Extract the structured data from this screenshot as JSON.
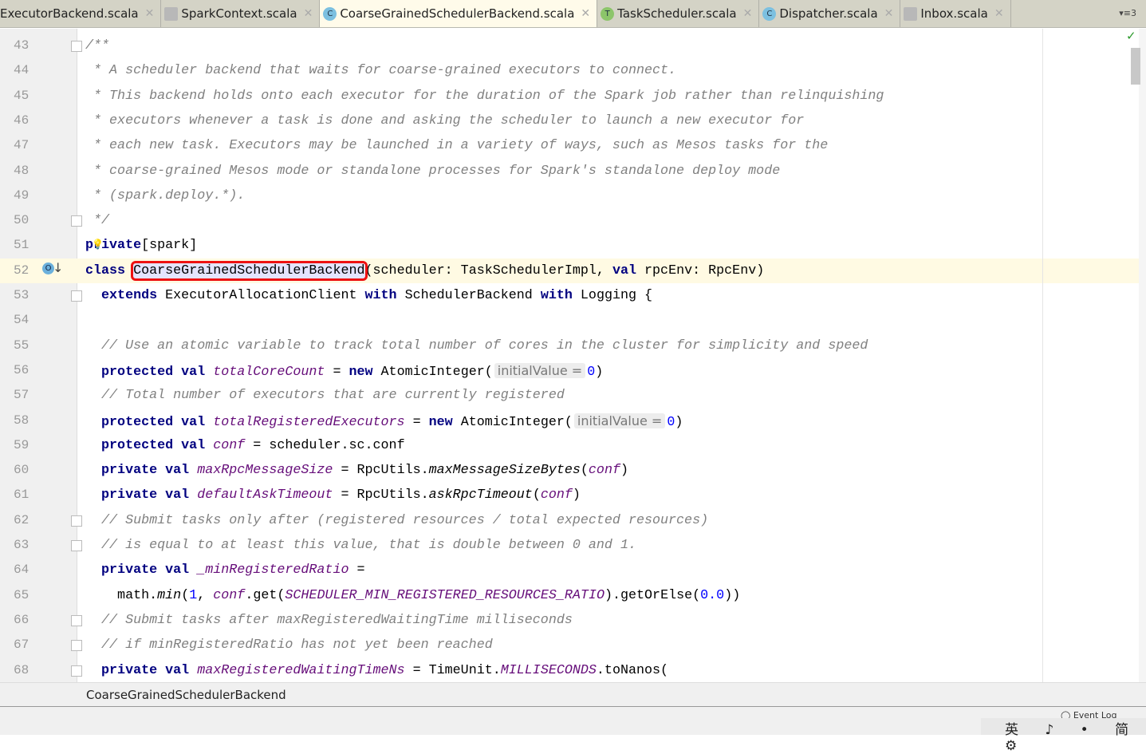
{
  "tabs": [
    {
      "label": "ExecutorBackend.scala",
      "icon": "scala-object-icon",
      "active": false
    },
    {
      "label": "SparkContext.scala",
      "icon": "scala-file-icon",
      "active": false
    },
    {
      "label": "CoarseGrainedSchedulerBackend.scala",
      "icon": "scala-class-icon",
      "active": true
    },
    {
      "label": "TaskScheduler.scala",
      "icon": "scala-trait-icon",
      "active": false
    },
    {
      "label": "Dispatcher.scala",
      "icon": "scala-class-icon",
      "active": false
    },
    {
      "label": "Inbox.scala",
      "icon": "scala-file-icon",
      "active": false
    }
  ],
  "tabs_more": "▾≡3",
  "colors": {
    "keyword": "#000080",
    "comment": "#808080",
    "field": "#660e7a",
    "number": "#0000ff",
    "highlight_box": "#ee1111",
    "current_line": "#fffae3"
  },
  "current_line": 52,
  "lines": [
    {
      "n": "43",
      "fold": true,
      "t": [
        [
          "cm",
          "/**"
        ]
      ]
    },
    {
      "n": "44",
      "t": [
        [
          "cm",
          " * A scheduler backend that waits for coarse-grained executors to connect."
        ]
      ]
    },
    {
      "n": "45",
      "t": [
        [
          "cm",
          " * This backend holds onto each executor for the duration of the Spark job rather than relinquishing"
        ]
      ]
    },
    {
      "n": "46",
      "t": [
        [
          "cm",
          " * executors whenever a task is done and asking the scheduler to launch a new executor for"
        ]
      ]
    },
    {
      "n": "47",
      "t": [
        [
          "cm",
          " * each new task. Executors may be launched in a variety of ways, such as Mesos tasks for the"
        ]
      ]
    },
    {
      "n": "48",
      "t": [
        [
          "cm",
          " * coarse-grained Mesos mode or standalone processes for Spark's standalone deploy mode"
        ]
      ]
    },
    {
      "n": "49",
      "t": [
        [
          "cm",
          " * (spark.deploy.*)."
        ]
      ]
    },
    {
      "n": "50",
      "fold": true,
      "t": [
        [
          "cm",
          " */"
        ]
      ]
    },
    {
      "n": "51",
      "t": [
        [
          "kw",
          "private"
        ],
        [
          "",
          "[spark]"
        ]
      ]
    },
    {
      "n": "52",
      "t": [
        [
          "kw",
          "class "
        ],
        [
          "hl",
          "CoarseGrainedSchedulerBackend"
        ],
        [
          "",
          "(scheduler: TaskSchedulerImpl, "
        ],
        [
          "kw",
          "val "
        ],
        [
          "",
          "rpcEnv: RpcEnv)"
        ]
      ]
    },
    {
      "n": "53",
      "fold": true,
      "t": [
        [
          "",
          "  "
        ],
        [
          "kw",
          "extends "
        ],
        [
          "",
          "ExecutorAllocationClient "
        ],
        [
          "kw",
          "with "
        ],
        [
          "",
          "SchedulerBackend "
        ],
        [
          "kw",
          "with "
        ],
        [
          "",
          "Logging {"
        ]
      ]
    },
    {
      "n": "54",
      "t": []
    },
    {
      "n": "55",
      "t": [
        [
          "cm",
          "  // Use an atomic variable to track total number of cores in the cluster for simplicity and speed"
        ]
      ]
    },
    {
      "n": "56",
      "t": [
        [
          "kw",
          "  protected val "
        ],
        [
          "fld",
          "totalCoreCount"
        ],
        [
          "",
          " = "
        ],
        [
          "kw",
          "new "
        ],
        [
          "",
          "AtomicInteger("
        ],
        [
          "hint",
          "initialValue ="
        ],
        [
          "num",
          "0"
        ],
        [
          "",
          ")"
        ]
      ]
    },
    {
      "n": "57",
      "t": [
        [
          "cm",
          "  // Total number of executors that are currently registered"
        ]
      ]
    },
    {
      "n": "58",
      "t": [
        [
          "kw",
          "  protected val "
        ],
        [
          "fld",
          "totalRegisteredExecutors"
        ],
        [
          "",
          " = "
        ],
        [
          "kw",
          "new "
        ],
        [
          "",
          "AtomicInteger("
        ],
        [
          "hint",
          "initialValue ="
        ],
        [
          "num",
          "0"
        ],
        [
          "",
          ")"
        ]
      ]
    },
    {
      "n": "59",
      "t": [
        [
          "kw",
          "  protected val "
        ],
        [
          "fld",
          "conf"
        ],
        [
          "",
          " = scheduler.sc.conf"
        ]
      ]
    },
    {
      "n": "60",
      "t": [
        [
          "kw",
          "  private val "
        ],
        [
          "fld",
          "maxRpcMessageSize"
        ],
        [
          "",
          " = RpcUtils."
        ],
        [
          "it",
          "maxMessageSizeBytes"
        ],
        [
          "",
          "("
        ],
        [
          "fld",
          "conf"
        ],
        [
          "",
          ")"
        ]
      ]
    },
    {
      "n": "61",
      "t": [
        [
          "kw",
          "  private val "
        ],
        [
          "fld",
          "defaultAskTimeout"
        ],
        [
          "",
          " = RpcUtils."
        ],
        [
          "it",
          "askRpcTimeout"
        ],
        [
          "",
          "("
        ],
        [
          "fld",
          "conf"
        ],
        [
          "",
          ")"
        ]
      ]
    },
    {
      "n": "62",
      "fold": true,
      "t": [
        [
          "cm",
          "  // Submit tasks only after (registered resources / total expected resources)"
        ]
      ]
    },
    {
      "n": "63",
      "fold": true,
      "t": [
        [
          "cm",
          "  // is equal to at least this value, that is double between 0 and 1."
        ]
      ]
    },
    {
      "n": "64",
      "t": [
        [
          "kw",
          "  private val "
        ],
        [
          "fld",
          "_minRegisteredRatio"
        ],
        [
          "",
          " ="
        ]
      ]
    },
    {
      "n": "65",
      "t": [
        [
          "",
          "    math."
        ],
        [
          "it",
          "min"
        ],
        [
          "",
          "("
        ],
        [
          "num",
          "1"
        ],
        [
          "",
          ", "
        ],
        [
          "fld",
          "conf"
        ],
        [
          "",
          ".get("
        ],
        [
          "fld",
          "SCHEDULER_MIN_REGISTERED_RESOURCES_RATIO"
        ],
        [
          "",
          ").getOrElse("
        ],
        [
          "num",
          "0.0"
        ],
        [
          "",
          "))"
        ]
      ]
    },
    {
      "n": "66",
      "fold": true,
      "t": [
        [
          "cm",
          "  // Submit tasks after maxRegisteredWaitingTime milliseconds"
        ]
      ]
    },
    {
      "n": "67",
      "fold": true,
      "t": [
        [
          "cm",
          "  // if minRegisteredRatio has not yet been reached"
        ]
      ]
    },
    {
      "n": "68",
      "fold": true,
      "t": [
        [
          "kw",
          "  private val "
        ],
        [
          "fld",
          "maxRegisteredWaitingTimeNs"
        ],
        [
          "",
          " = TimeUnit."
        ],
        [
          "fld",
          "MILLISECONDS"
        ],
        [
          "",
          ".toNanos("
        ]
      ]
    }
  ],
  "breadcrumb": "CoarseGrainedSchedulerBackend",
  "event_log": "Event Log",
  "ime": "英 ♪ • 简 ⚙"
}
